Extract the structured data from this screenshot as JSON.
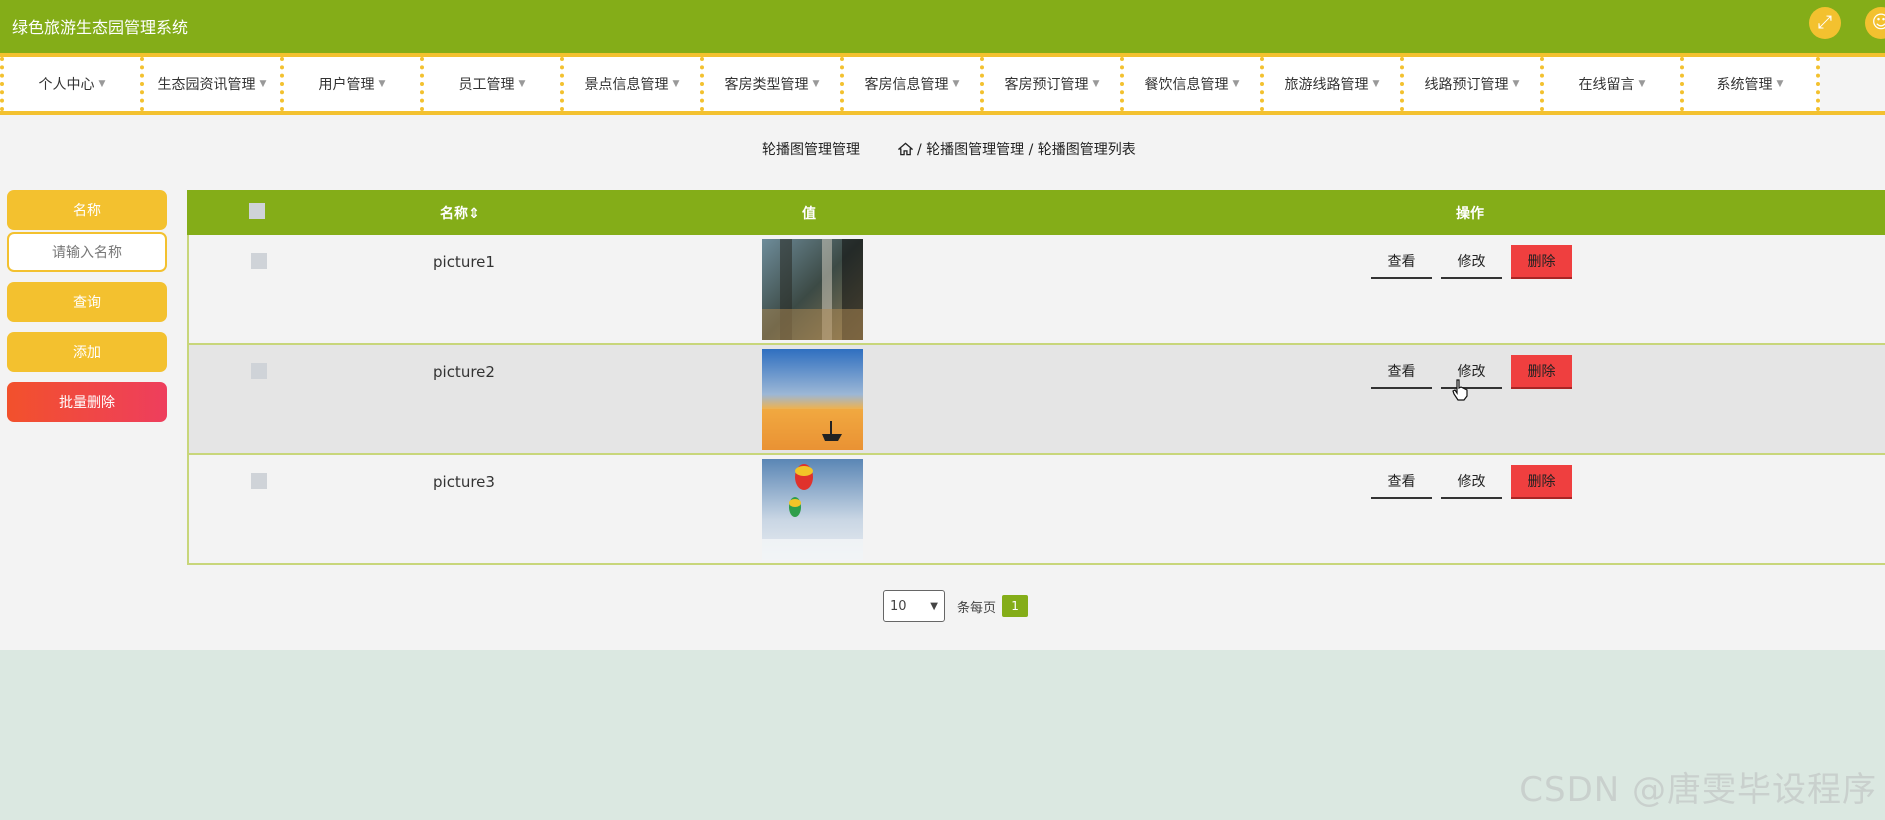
{
  "app": {
    "title": "绿色旅游生态园管理系统"
  },
  "nav": {
    "items": [
      "个人中心",
      "生态园资讯管理",
      "用户管理",
      "员工管理",
      "景点信息管理",
      "客房类型管理",
      "客房信息管理",
      "客房预订管理",
      "餐饮信息管理",
      "旅游线路管理",
      "线路预订管理",
      "在线留言",
      "系统管理"
    ]
  },
  "breadcrumb": {
    "title": "轮播图管理管理",
    "path": "/ 轮播图管理管理 / 轮播图管理列表"
  },
  "search": {
    "label": "名称",
    "placeholder": "请输入名称",
    "query_label": "查询",
    "add_label": "添加",
    "batch_delete_label": "批量删除"
  },
  "table": {
    "headers": {
      "name": "名称",
      "value": "值",
      "actions": "操作",
      "sort_icon": "sort-icon"
    },
    "rows": [
      {
        "name": "picture1",
        "image": "blurred-canal-photo"
      },
      {
        "name": "picture2",
        "image": "sunset-boat-photo"
      },
      {
        "name": "picture3",
        "image": "hot-air-balloon-photo"
      }
    ],
    "actions": {
      "view": "查看",
      "edit": "修改",
      "delete": "删除"
    }
  },
  "pagination": {
    "page_size": "10",
    "per_page_label": "条每页",
    "current_page": "1"
  },
  "watermark": "CSDN @唐雯毕设程序",
  "colors": {
    "primary": "#84ad18",
    "accent": "#f3c12f",
    "danger": "#ef3f3f"
  }
}
